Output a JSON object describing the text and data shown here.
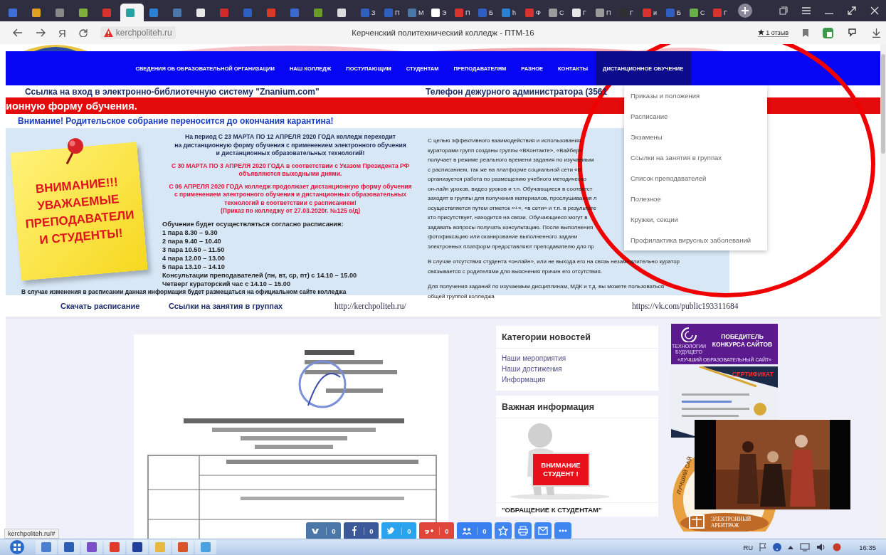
{
  "browser": {
    "tabs": [
      {
        "color": "#3e6fd8",
        "selected": false
      },
      {
        "color": "#e0a020",
        "selected": false
      },
      {
        "color": "#888888",
        "selected": false
      },
      {
        "color": "#7fb03a",
        "selected": false
      },
      {
        "color": "#d8322f",
        "selected": false
      },
      {
        "color": "#2aa0a0",
        "selected": true
      },
      {
        "color": "#2a7fd0",
        "selected": false
      },
      {
        "color": "#4a76a8",
        "selected": false
      },
      {
        "color": "#e8e8e8",
        "selected": false
      },
      {
        "color": "#d12a2a",
        "selected": false
      },
      {
        "color": "#2f5fc0",
        "selected": false
      },
      {
        "color": "#d83a2a",
        "selected": false
      },
      {
        "color": "#3a6ad0",
        "selected": false
      },
      {
        "color": "#6a9a2a",
        "selected": false
      },
      {
        "color": "#dcdcdc",
        "selected": false
      },
      {
        "color": "#2f5fc0",
        "label": "З",
        "selected": false
      },
      {
        "color": "#2f5fc0",
        "label": "П",
        "selected": false
      },
      {
        "color": "#4a76a8",
        "label": "М",
        "selected": false
      },
      {
        "color": "#ffffff",
        "label": "Э",
        "selected": false
      },
      {
        "color": "#d8322f",
        "label": "П",
        "selected": false
      },
      {
        "color": "#2f5fc0",
        "label": "Б",
        "selected": false
      },
      {
        "color": "#2a7fd0",
        "label": "h",
        "selected": false
      },
      {
        "color": "#d8322f",
        "label": "Ф",
        "selected": false
      },
      {
        "color": "#9a9a9a",
        "label": "С",
        "selected": false
      },
      {
        "color": "#e8e8e8",
        "label": "Г",
        "selected": false
      },
      {
        "color": "#9a9a9a",
        "label": "П",
        "selected": false
      },
      {
        "color": "#2f2f2f",
        "label": "Г",
        "selected": false
      },
      {
        "color": "#d8322f",
        "label": "и",
        "selected": false
      },
      {
        "color": "#2f5fc0",
        "label": "Б",
        "selected": false
      },
      {
        "color": "#6ab04a",
        "label": "С",
        "selected": false
      },
      {
        "color": "#d8322f",
        "label": "Г",
        "selected": false
      }
    ],
    "yandex_button": "Я",
    "address": "kerchpoliteh.ru",
    "page_title": "Керченский политехнический колледж - ПТМ-16",
    "reviews": "1 отзыв"
  },
  "site": {
    "nav": [
      {
        "label": "СВЕДЕНИЯ ОБ ОБРАЗОВАТЕЛЬНОЙ ОРГАНИЗАЦИИ",
        "selected": false
      },
      {
        "label": "НАШ КОЛЛЕДЖ",
        "selected": false
      },
      {
        "label": "ПОСТУПАЮЩИМ",
        "selected": false
      },
      {
        "label": "СТУДЕНТАМ",
        "selected": false
      },
      {
        "label": "ПРЕПОДАВАТЕЛЯМ",
        "selected": false
      },
      {
        "label": "РАЗНОЕ",
        "selected": false
      },
      {
        "label": "КОНТАКТЫ",
        "selected": false
      },
      {
        "label": "ДИСТАНЦИОННОЕ ОБУЧЕНИЕ",
        "selected": true
      }
    ],
    "dropdown": [
      "Приказы и положения",
      "Расписание",
      "Экзамены",
      "Ссылки на занятия в группах",
      "Список преподавателей",
      "Полезное",
      "Кружки, секции",
      "Профилактика вирусных заболеваний"
    ],
    "library_link": "Ссылка на вход в электронно-библиотечную систему \"Znanium.com\"",
    "duty_phone": "Телефон дежурного администратора (3561",
    "ticker": "ионную форму обучения.",
    "notice": "Внимание! Родительское собрание переносится до окончания карантина!",
    "poster": [
      "ВНИМАНИЕ!!!",
      "УВАЖАЕМЫЕ",
      "ПРЕПОДАВАТЕЛИ",
      "И СТУДЕНТЫ!"
    ],
    "announcement": [
      {
        "kind": "info",
        "lines": [
          "На период С 23 МАРТА ПО 12 АПРЕЛЯ 2020 ГОДА колледж переходит",
          "на дистанционную форму обучения с применением электронного обучения",
          "и дистанционных образовательных технологий!"
        ]
      },
      {
        "kind": "alert",
        "lines": [
          "С 30 МАРТА ПО 3 АПРЕЛЯ 2020 ГОДА в соответствии с Указом Президента РФ",
          "объявляются выходными днями."
        ]
      },
      {
        "kind": "alert",
        "lines": [
          "С 06 АПРЕЛЯ 2020 ГОДА колледж продолжает дистанционную форму обучения",
          "с применением электронного обучения и дистанционных образовательных",
          "технологий в соответствии с расписанием!",
          "(Приказ по колледжу от 27.03.2020г. №125 о/д)"
        ]
      }
    ],
    "schedule": [
      "Обучение будет осуществляться согласно  расписания:",
      "1 пара 8.30 – 9.30",
      "2 пара 9.40 – 10.40",
      "3 пара 10.50 – 11.50",
      "4 пара 12.00 – 13.00",
      "5 пара 13.10 – 14.10",
      "Консультации преподавателей (пн, вт, ср, пт) с 14.10 – 15.00",
      "Четверг кураторский час с 14.10 – 15.00"
    ],
    "schedule_note": "В случае изменения в расписании данная информация будет размещаться на официальном сайте колледжа",
    "details": [
      {
        "lines": [
          "С целью эффективного взаимодействия и использования",
          "кураторами групп созданы группы «ВКонтакте», «Вайбер»",
          "получает в режиме реального времени задания по изучаемым",
          "с расписанием, так же на платформе социальной сети «В",
          "организуется работа по размещению учебного методическо",
          "он-лайн уроков, видео уроков и т.п. Обучающиеся в соответст",
          "заходят в группы для получения материалов, прослушивания л",
          "осуществляется путем отметок «+», «в сети» и т.п. в результате",
          "кто присутствует, находится на связи. Обучающиеся могут в",
          "задавать вопросы получать консультацию. После выполнения",
          "фотофиксацию или сканирование выполненного задани",
          "электронных платформ предоставляют преподавателю для пр"
        ]
      },
      {
        "lines": [
          "В случае отсутствия студента «онлайн», или не выхода его на связь незамедлительно куратор",
          "связывается с родителями для выяснения причин его отсутствия."
        ]
      },
      {
        "lines": [
          "Для получения заданий по изучаемым дисциплинам, МДК и т.д.  вы можете пользоваться",
          "общей группой колледжа"
        ]
      }
    ],
    "links": [
      "Скачать расписание",
      "Ссылки на занятия в группах"
    ],
    "site_url": "http://kerchpoliteh.ru/",
    "vk_url": "https://vk.com/public193311684",
    "document": {
      "kind": "picture"
    },
    "categories": {
      "title": "Категории новостей",
      "items": [
        "Наши мероприятия",
        "Наши достижения",
        "Информация"
      ]
    },
    "important": {
      "title": "Важная информация",
      "sign": [
        "ВНИМАНИЕ",
        "СТУДЕНТ !"
      ],
      "appeal": "\"ОБРАЩЕНИЕ К СТУДЕНТАМ\""
    },
    "awards": {
      "winner": [
        "ПОБЕДИТЕЛЬ",
        "КОНКУРСА САЙТОВ"
      ],
      "winner_sub": "«ЛУЧШИЙ ОБРАЗОВАТЕЛЬНЫЙ САЙТ»",
      "winner_logo": "ТЕХНОЛОГИИ БУДУЩЕГО",
      "certificate": "СЕРТИФИКАТ",
      "badge_arc": "ЛУЧШИЙ САЙ",
      "badge": [
        "ЭЛЕКТРОННЫЙ",
        "АРБИТРАЖ"
      ]
    },
    "video": {
      "kind": "picture"
    },
    "share": [
      {
        "kind": "vk",
        "count": "0"
      },
      {
        "kind": "facebook",
        "count": "0"
      },
      {
        "kind": "twitter",
        "count": "0"
      },
      {
        "kind": "gplus",
        "count": "0"
      },
      {
        "kind": "ok",
        "count": "0"
      },
      {
        "kind": "favorite"
      },
      {
        "kind": "print"
      },
      {
        "kind": "mail"
      },
      {
        "kind": "more"
      }
    ],
    "status_url": "kerchpoliteh.ru/#"
  },
  "taskbar": {
    "apps": [
      {
        "color": "#4a7fd0"
      },
      {
        "color": "#2b5fb4"
      },
      {
        "color": "#7b4fc8"
      },
      {
        "color": "#e03a2a"
      },
      {
        "color": "#1f3f9a"
      },
      {
        "color": "#e8b840"
      },
      {
        "color": "#d9542a"
      },
      {
        "color": "#4aa0e0"
      }
    ],
    "language": "RU",
    "time": "16:35"
  }
}
